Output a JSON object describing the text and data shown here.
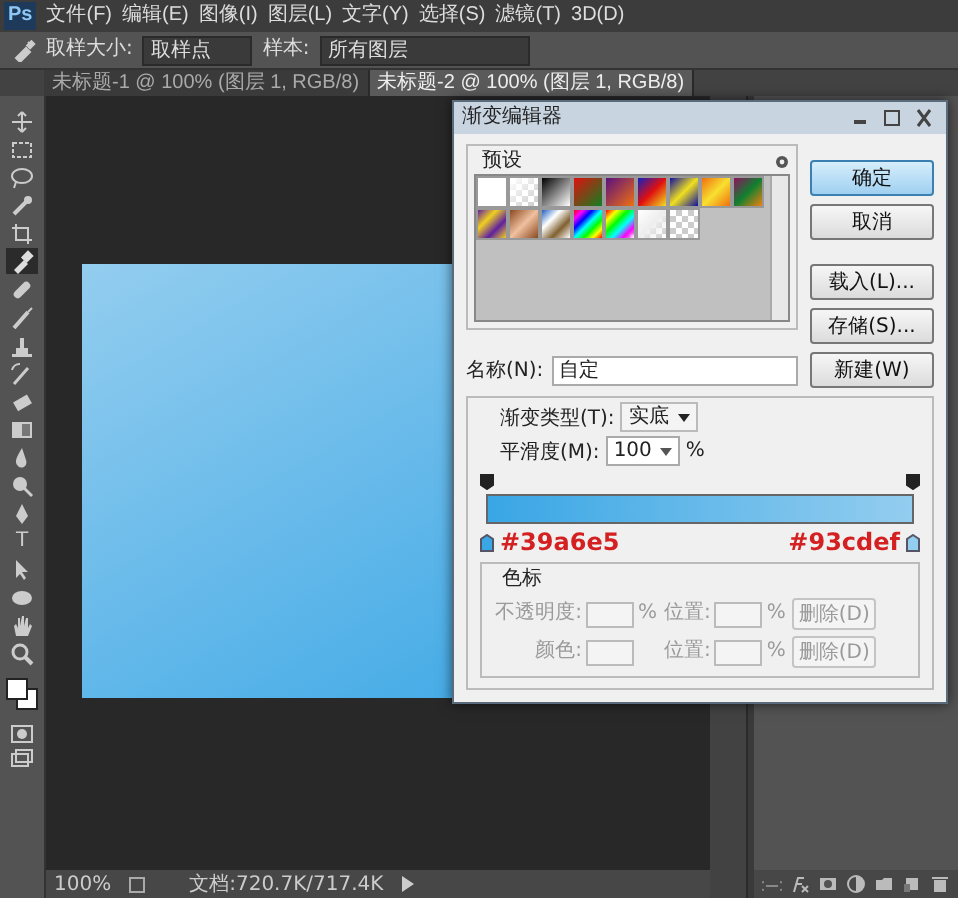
{
  "app": {
    "logo": "Ps"
  },
  "menu": [
    {
      "label": "文件(F)"
    },
    {
      "label": "编辑(E)"
    },
    {
      "label": "图像(I)"
    },
    {
      "label": "图层(L)"
    },
    {
      "label": "文字(Y)"
    },
    {
      "label": "选择(S)"
    },
    {
      "label": "滤镜(T)"
    },
    {
      "label": "3D(D)"
    }
  ],
  "options_bar": {
    "size_label": "取样大小:",
    "size_value": "取样点",
    "sample_label": "样本:",
    "sample_value": "所有图层"
  },
  "tabs": [
    {
      "label": "未标题-1 @ 100% (图层 1, RGB/8)",
      "selected": false
    },
    {
      "label": "未标题-2 @ 100% (图层 1, RGB/8)",
      "selected": true
    }
  ],
  "tools": [
    {
      "selected": false
    },
    {
      "selected": false
    },
    {
      "selected": false
    },
    {
      "selected": false
    },
    {
      "selected": false
    },
    {
      "selected": true
    },
    {
      "selected": false
    },
    {
      "selected": false
    },
    {
      "selected": false
    },
    {
      "selected": false
    },
    {
      "selected": false
    },
    {
      "selected": false
    },
    {
      "selected": false
    },
    {
      "selected": false
    },
    {
      "selected": false
    },
    {
      "selected": false,
      "glyph": "T"
    },
    {
      "selected": false
    },
    {
      "selected": false
    },
    {
      "selected": false
    },
    {
      "selected": false
    }
  ],
  "status_bar": {
    "zoom": "100%",
    "doc_info": "文档:720.7K/717.4K"
  },
  "dialog": {
    "title": "渐变编辑器",
    "presets_label": "预设",
    "buttons": [
      {
        "label": "确定",
        "default": true
      },
      {
        "label": "取消",
        "default": false
      },
      {
        "label": "载入(L)...",
        "default": false
      },
      {
        "label": "存储(S)...",
        "default": false
      }
    ],
    "name_label": "名称(N):",
    "name_value": "自定",
    "new_button": "新建(W)",
    "type_label": "渐变类型(T):",
    "type_value": "实底",
    "smooth_label": "平滑度(M):",
    "smooth_value": "100",
    "smooth_unit": "%",
    "stops": [
      {
        "label": "#39a6e5",
        "color": "#39a6e5"
      },
      {
        "label": "#93cdef",
        "color": "#93cdef"
      }
    ],
    "stop_section": {
      "title": "色标",
      "disabled": true,
      "rows": [
        {
          "label": "不透明度:",
          "unit": "%",
          "position_label": "位置:",
          "position_unit": "%",
          "delete": "删除(D)"
        },
        {
          "label": "颜色:",
          "position_label": "位置:",
          "position_unit": "%",
          "delete": "删除(D)"
        }
      ]
    }
  }
}
